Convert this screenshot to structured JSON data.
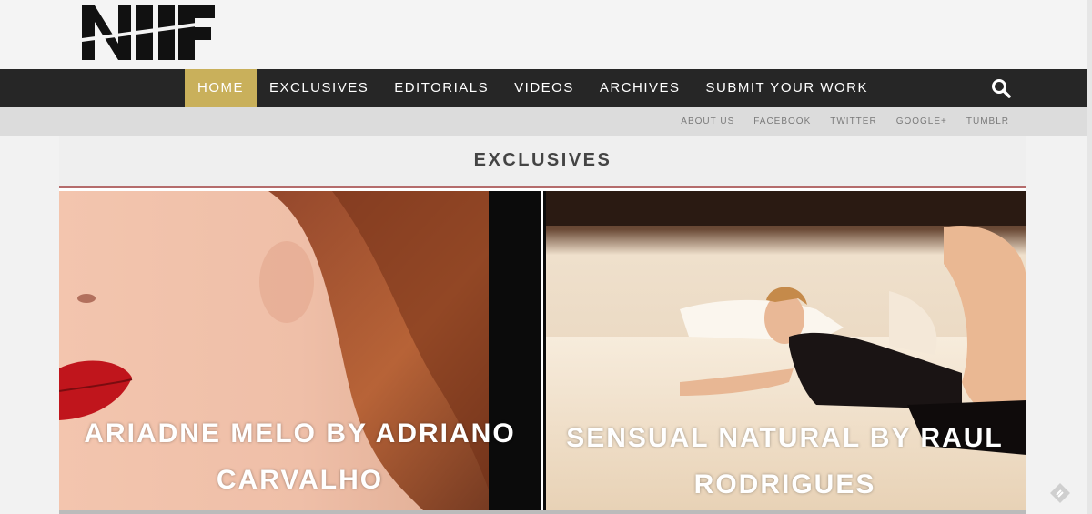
{
  "logo": {
    "text": "NIF"
  },
  "nav": {
    "items": [
      "HOME",
      "EXCLUSIVES",
      "EDITORIALS",
      "VIDEOS",
      "ARCHIVES",
      "SUBMIT YOUR WORK"
    ],
    "active": "HOME",
    "search_icon": "search-icon"
  },
  "subnav": {
    "items": [
      "ABOUT US",
      "FACEBOOK",
      "TWITTER",
      "GOOGLE+",
      "TUMBLR"
    ]
  },
  "section": {
    "title": "EXCLUSIVES"
  },
  "cards": [
    {
      "title_line1": "ARIADNE MELO BY ADRIANO",
      "title_line2": "CARVALHO"
    },
    {
      "title_line1": "SENSUAL NATURAL BY RAUL",
      "title_line2": "RODRIGUES"
    }
  ],
  "colors": {
    "nav_bg": "#262626",
    "nav_active": "#c9b05b",
    "subnav_bg": "#dcdcdc",
    "accent_rule": "#b56c6c"
  }
}
